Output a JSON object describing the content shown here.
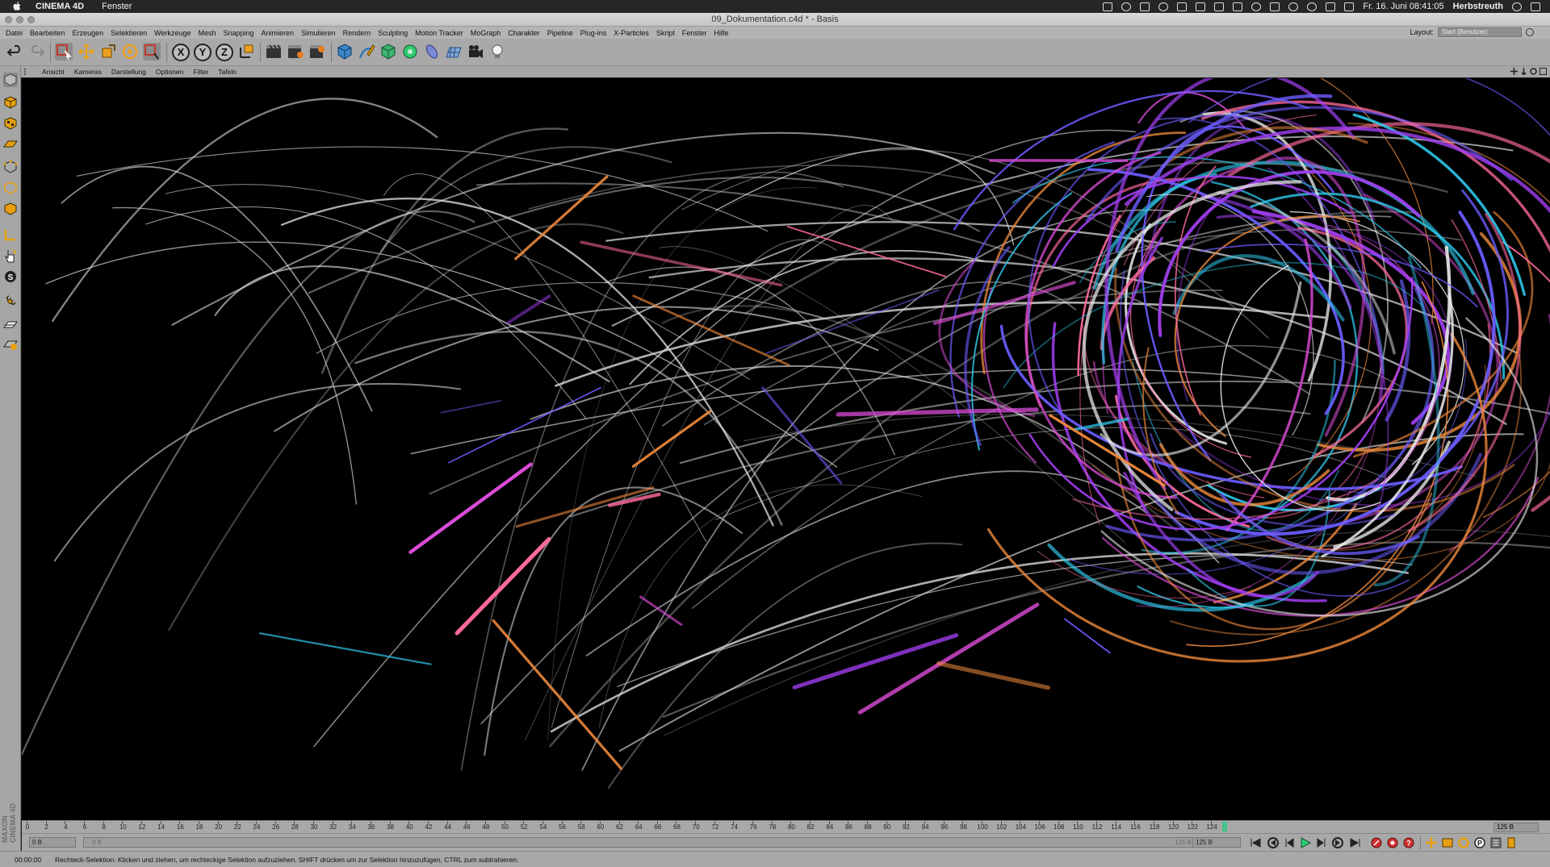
{
  "macos": {
    "app_name": "CINEMA 4D",
    "menu": [
      "Fenster"
    ],
    "date_time": "Fr. 16. Juni  08:41:05",
    "user": "Herbstreuth"
  },
  "window": {
    "title": "09_Dokumentation.c4d * - Basis"
  },
  "menubar": {
    "items": [
      "Datei",
      "Bearbeiten",
      "Erzeugen",
      "Selektieren",
      "Werkzeuge",
      "Mesh",
      "Snapping",
      "Animieren",
      "Simulieren",
      "Rendern",
      "Sculpting",
      "Motion Tracker",
      "MoGraph",
      "Charakter",
      "Pipeline",
      "Plug-ins",
      "X-Particles",
      "Skript",
      "Fenster",
      "Hilfe"
    ],
    "layout_label": "Layout:",
    "layout_value": "Start (Benutzer)"
  },
  "toolbar": {
    "axis_labels": [
      "X",
      "Y",
      "Z"
    ]
  },
  "viewbar": {
    "items": [
      "Ansicht",
      "Kameras",
      "Darstellung",
      "Optionen",
      "Filter",
      "Tafeln"
    ]
  },
  "palette": {
    "logo_top": "MAXON",
    "logo_bottom": "CINEMA 4D"
  },
  "timeline": {
    "ticks": [
      "0",
      "2",
      "4",
      "6",
      "8",
      "10",
      "12",
      "14",
      "16",
      "18",
      "20",
      "22",
      "24",
      "26",
      "28",
      "30",
      "32",
      "34",
      "36",
      "38",
      "40",
      "42",
      "44",
      "46",
      "48",
      "50",
      "52",
      "54",
      "56",
      "58",
      "60",
      "62",
      "64",
      "66",
      "68",
      "70",
      "72",
      "74",
      "76",
      "78",
      "80",
      "82",
      "84",
      "86",
      "88",
      "90",
      "92",
      "94",
      "96",
      "98",
      "100",
      "102",
      "104",
      "106",
      "108",
      "110",
      "112",
      "114",
      "116",
      "118",
      "120",
      "122",
      "124"
    ],
    "current_frame": 125,
    "end_frame": "125 B"
  },
  "transport": {
    "current_field": "0 B",
    "start_field": "0 B",
    "end_range_field": "125 B",
    "max_field": "125 B"
  },
  "statusbar": {
    "time": "00:00:00",
    "message": "Rechteck-Selektion: Klicken und ziehen, um rechteckige Selektion aufzuziehen. SHIFT drücken um zur Selektion hinzuzufügen, CTRL zum subtrahieren."
  },
  "colors": {
    "viewport_bg": "#000000",
    "ui_gray": "#a8a8a8",
    "accent_orange": "#f0a020",
    "accent_green": "#42c48a",
    "accent_red": "#d23030"
  }
}
